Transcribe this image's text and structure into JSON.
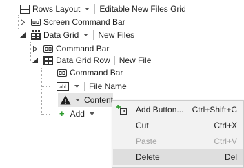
{
  "tree": {
    "rows_layout": {
      "label": "Rows Layout",
      "detail": "Editable New Files Grid",
      "icon": "rows-layout-icon"
    },
    "screen_command_bar": {
      "label": "Screen Command Bar",
      "icon": "command-bar-icon"
    },
    "data_grid": {
      "label": "Data Grid",
      "detail": "New Files",
      "icon": "data-grid-icon"
    },
    "command_bar": {
      "label": "Command Bar",
      "icon": "command-bar-icon"
    },
    "data_grid_row": {
      "label": "Data Grid Row",
      "detail": "New File",
      "icon": "data-grid-row-icon"
    },
    "row_command_bar": {
      "label": "Command Bar",
      "icon": "command-bar-icon"
    },
    "file_name": {
      "label": "File Name",
      "icon": "textbox-icon",
      "icon_text": "abl"
    },
    "content": {
      "label": "Content",
      "icon": "warning-icon",
      "icon_text": "!"
    },
    "add": {
      "label": "Add",
      "icon": "plus-icon",
      "icon_text": "+"
    }
  },
  "context_menu": {
    "items": [
      {
        "label": "Add Button...",
        "shortcut": "Ctrl+Shift+C",
        "icon": "add-button-icon",
        "enabled": true
      },
      {
        "label": "Cut",
        "shortcut": "Ctrl+X",
        "icon": "",
        "enabled": true
      },
      {
        "label": "Paste",
        "shortcut": "Ctrl+V",
        "icon": "",
        "enabled": false
      },
      {
        "label": "Delete",
        "shortcut": "Del",
        "icon": "",
        "enabled": true
      }
    ]
  },
  "colors": {
    "selected_row": "#e5e5e5",
    "menu_background": "#f2f2f2",
    "menu_hover": "#dedede",
    "add_plus": "#2e9b2e",
    "disabled_text": "#a3a3a3"
  }
}
